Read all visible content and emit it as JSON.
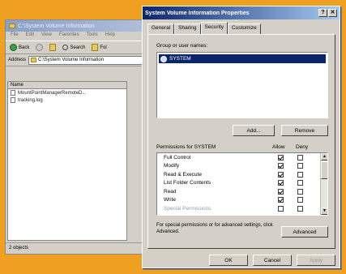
{
  "explorer": {
    "title": "C:\\System Volume Information",
    "menu": [
      "File",
      "Edit",
      "View",
      "Favorites",
      "Tools",
      "Help"
    ],
    "toolbar": {
      "back_label": "Back",
      "search_label": "Search",
      "folders_label": "Fol"
    },
    "address_label": "Address",
    "address_value": "C:\\System Volume Information",
    "list_header": "Name",
    "files": [
      "MountPointManagerRemoteD...",
      "tracking.log"
    ],
    "status_text": "2 objects"
  },
  "dialog": {
    "title": "System Volume Information Properties",
    "help_glyph": "?",
    "close_glyph": "✕",
    "tabs": [
      "General",
      "Sharing",
      "Security",
      "Customize"
    ],
    "group_label": "Group or user names:",
    "users": [
      "SYSTEM"
    ],
    "add_label": "Add...",
    "remove_label": "Remove",
    "permissions_label": "Permissions for SYSTEM",
    "allow_header": "Allow",
    "deny_header": "Deny",
    "permissions": [
      {
        "name": "Full Control",
        "allow": true,
        "deny": false
      },
      {
        "name": "Modify",
        "allow": true,
        "deny": false
      },
      {
        "name": "Read & Execute",
        "allow": true,
        "deny": false
      },
      {
        "name": "List Folder Contents",
        "allow": true,
        "deny": false
      },
      {
        "name": "Read",
        "allow": true,
        "deny": false
      },
      {
        "name": "Write",
        "allow": true,
        "deny": false
      },
      {
        "name": "Special Permissions",
        "allow": false,
        "deny": false
      }
    ],
    "special_info": "For special permissions or for advanced settings, click Advanced.",
    "advanced_label": "Advanced",
    "ok_label": "OK",
    "cancel_label": "Cancel",
    "apply_label": "Apply"
  },
  "colors": {
    "desktop": "#f0a020",
    "title_bar_start": "#0a246a",
    "title_bar_end": "#a6caf0",
    "selection": "#0a246a",
    "face": "#d4d0c8"
  }
}
